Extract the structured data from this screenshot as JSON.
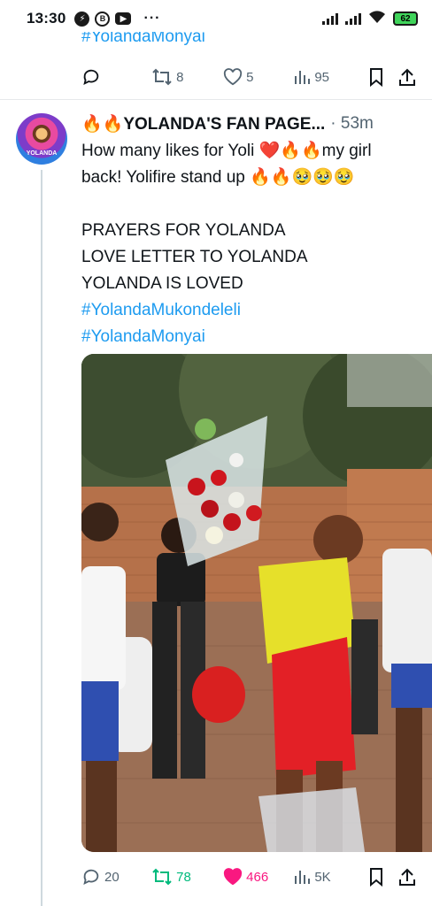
{
  "status_bar": {
    "time": "13:30",
    "battery": "62",
    "icons": [
      "messenger-icon",
      "b-icon",
      "youtube-icon",
      "more-dots",
      "signal-icon",
      "signal-icon",
      "wifi-icon",
      "battery-icon"
    ]
  },
  "prev_tweet": {
    "hashtag": "#YolandaMonyai",
    "retweets": "8",
    "likes": "5",
    "views": "95"
  },
  "tweet": {
    "author": "🔥🔥YOLANDA'S FAN PAGE...",
    "time": "· 53m",
    "avatar_label": "YOLANDA",
    "lines": [
      "How many likes for Yoli ❤️🔥🔥my girl",
      "back! Yolifire stand up 🔥🔥🥹🥹🥹",
      "",
      "PRAYERS FOR YOLANDA",
      "LOVE LETTER TO YOLANDA",
      "YOLANDA IS LOVED"
    ],
    "hashtags": [
      "#YolandaMukondeleli",
      "#YolandaMonyai"
    ],
    "replies": "20",
    "retweets": "78",
    "likes": "466",
    "views": "5K"
  },
  "colors": {
    "link": "#1d9bf0",
    "retweet": "#00ba7c",
    "like": "#f91880",
    "muted": "#536471"
  }
}
